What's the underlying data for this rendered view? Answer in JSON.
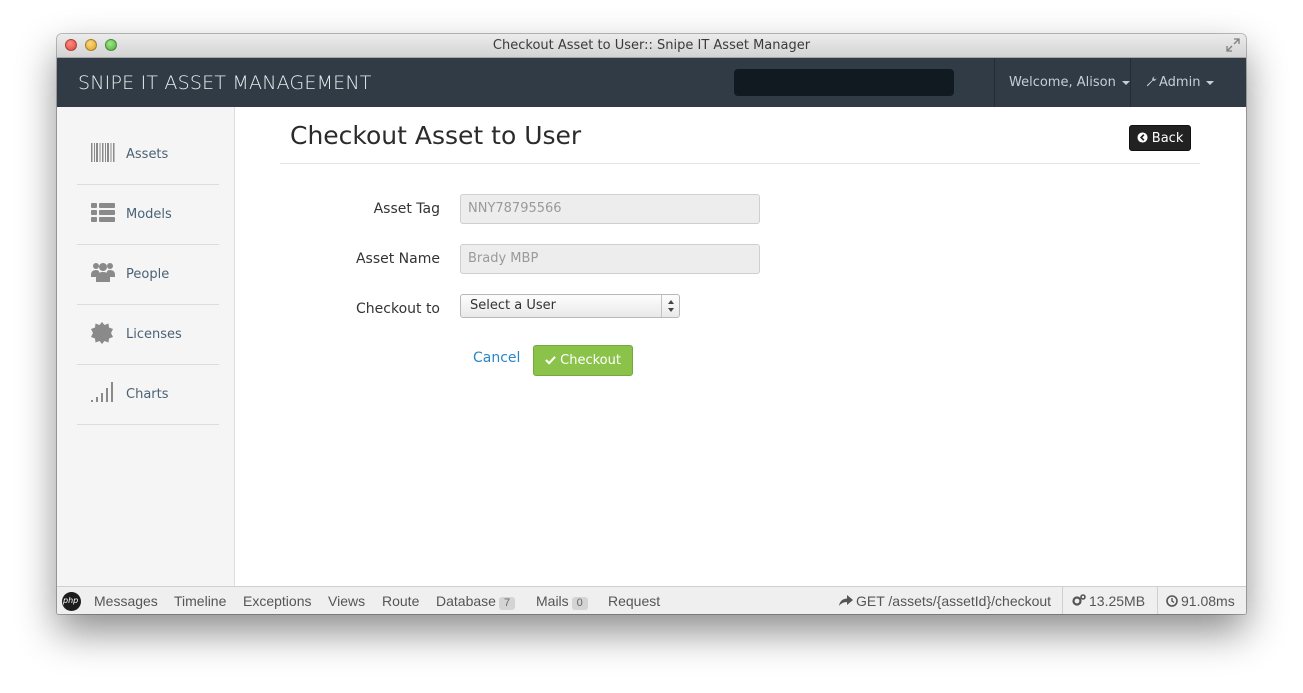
{
  "window": {
    "title": "Checkout Asset to User:: Snipe IT Asset Manager"
  },
  "navbar": {
    "brand": "SNIPE IT ASSET MANAGEMENT",
    "welcome": "Welcome, Alison",
    "admin": "Admin"
  },
  "sidebar": {
    "items": [
      {
        "label": "Assets",
        "icon": "barcode-icon"
      },
      {
        "label": "Models",
        "icon": "list-icon"
      },
      {
        "label": "People",
        "icon": "users-icon"
      },
      {
        "label": "Licenses",
        "icon": "certificate-icon"
      },
      {
        "label": "Charts",
        "icon": "signal-bars-icon"
      }
    ]
  },
  "main": {
    "title": "Checkout Asset to User",
    "back_label": "Back",
    "form": {
      "asset_tag_label": "Asset Tag",
      "asset_tag_value": "NNY78795566",
      "asset_name_label": "Asset Name",
      "asset_name_value": "Brady MBP",
      "checkout_to_label": "Checkout to",
      "checkout_to_selected": "Select a User",
      "cancel_label": "Cancel",
      "checkout_label": "Checkout"
    }
  },
  "debugbar": {
    "tabs": [
      "Messages",
      "Timeline",
      "Exceptions",
      "Views",
      "Route",
      "Database",
      "Mails",
      "Request"
    ],
    "database_count": "7",
    "mails_count": "0",
    "route": "GET /assets/{assetId}/checkout",
    "memory": "13.25MB",
    "time": "91.08ms"
  },
  "colors": {
    "navbar_bg": "#303b45",
    "checkout_btn": "#8bc34a",
    "link": "#2a86c6",
    "sidebar_bg": "#f5f5f5"
  }
}
